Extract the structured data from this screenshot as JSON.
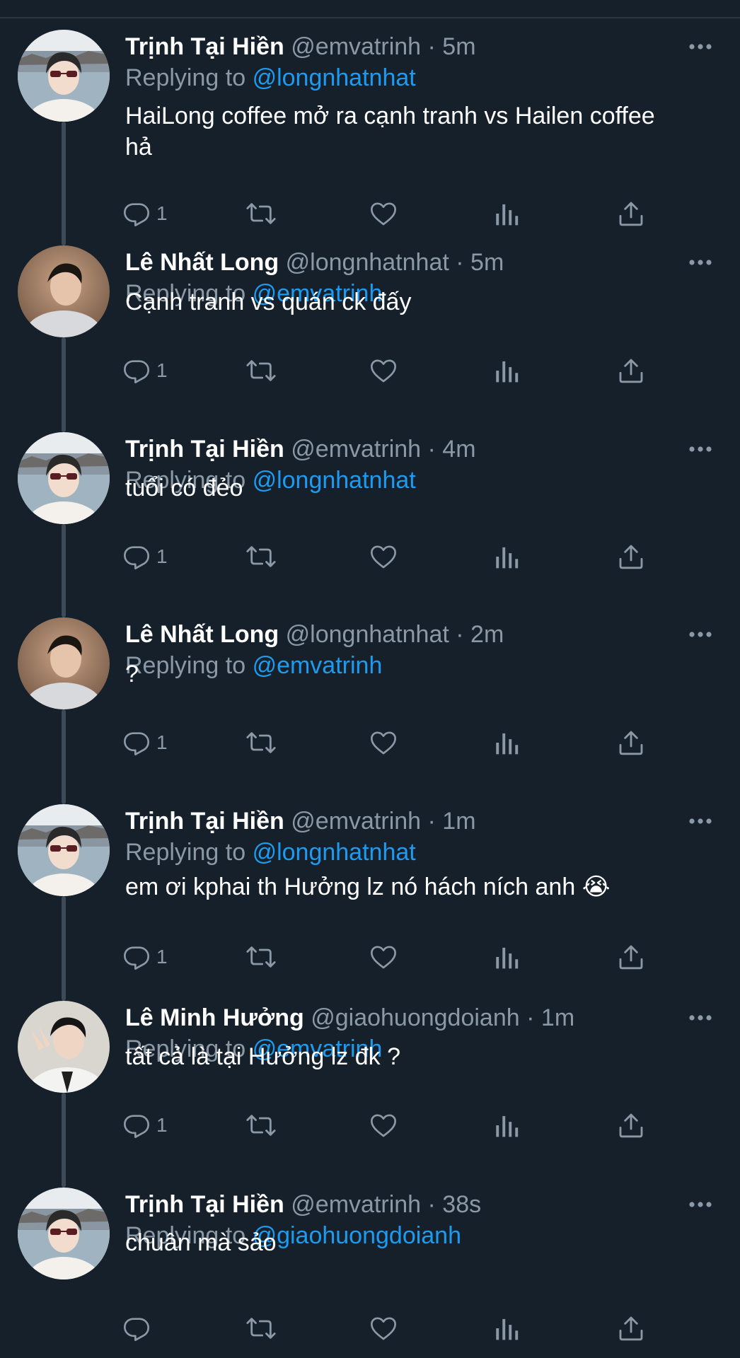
{
  "tweets": [
    {
      "name": "Trịnh Tại Hiền",
      "handle": "@emvatrinh",
      "separator": "·",
      "time": "5m",
      "replying_prefix": "Replying to",
      "replying_to": "@longnhatnhat",
      "text_lines": [
        "HaiLong coffee mở ra cạnh tranh vs Hailen coffee",
        "hả"
      ],
      "reply_count": "1",
      "avatar": "avatar-hien"
    },
    {
      "name": "Lê Nhất Long",
      "handle": "@longnhatnhat",
      "separator": "·",
      "time": "5m",
      "replying_prefix": "Replying to",
      "replying_to": "@emvatrinh",
      "text_lines": [
        "Cạnh tranh vs quán ck đấy"
      ],
      "reply_count": "1",
      "avatar": "avatar-long"
    },
    {
      "name": "Trịnh Tại Hiền",
      "handle": "@emvatrinh",
      "separator": "·",
      "time": "4m",
      "replying_prefix": "Replying to",
      "replying_to": "@longnhatnhat",
      "text_lines": [
        "tuổi có đẻo"
      ],
      "reply_count": "1",
      "avatar": "avatar-hien"
    },
    {
      "name": "Lê Nhất Long",
      "handle": "@longnhatnhat",
      "separator": "·",
      "time": "2m",
      "replying_prefix": "Replying to",
      "replying_to": "@emvatrinh",
      "text_lines": [
        "?"
      ],
      "reply_count": "1",
      "avatar": "avatar-long"
    },
    {
      "name": "Trịnh Tại Hiền",
      "handle": "@emvatrinh",
      "separator": "·",
      "time": "1m",
      "replying_prefix": "Replying to",
      "replying_to": "@longnhatnhat",
      "text_lines": [
        "em ơi kphai th Hưởng lz nó hách ních anh 😭"
      ],
      "reply_count": "1",
      "avatar": "avatar-hien"
    },
    {
      "name": "Lê Minh Hưởng",
      "handle": "@giaohuongdoianh",
      "separator": "·",
      "time": "1m",
      "replying_prefix": "Replying to",
      "replying_to": "@emvatrinh",
      "text_lines": [
        "tất cả là tại Hưởng lz đk ?"
      ],
      "reply_count": "1",
      "avatar": "avatar-huong"
    },
    {
      "name": "Trịnh Tại Hiền",
      "handle": "@emvatrinh",
      "separator": "·",
      "time": "38s",
      "replying_prefix": "Replying to",
      "replying_to": "@giaohuongdoianh",
      "text_lines": [
        "chuân mà sảo"
      ],
      "reply_count": "",
      "avatar": "avatar-hien"
    }
  ],
  "colors": {
    "background": "#15202b",
    "secondary_text": "#8b98a5",
    "mention": "#1d9bf0",
    "thread_line": "#3d4a57"
  }
}
